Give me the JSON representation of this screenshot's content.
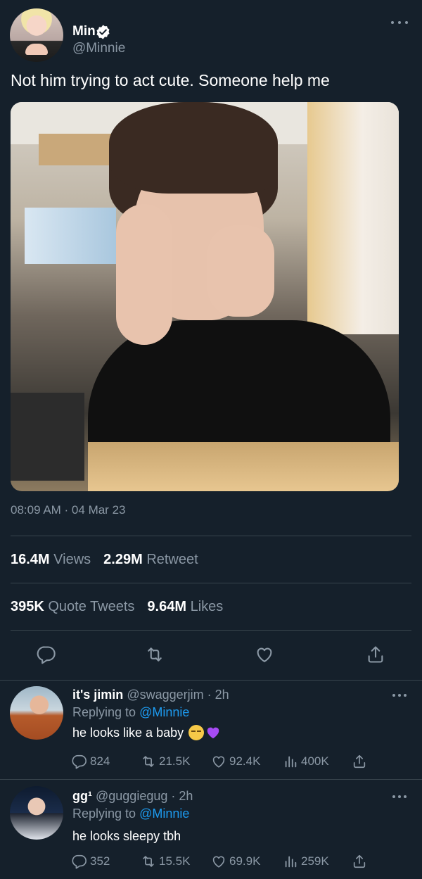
{
  "tweet": {
    "display_name": "Min",
    "handle": "@Minnie",
    "text": "Not him trying to act cute. Someone help me",
    "timestamp": "08:09 AM · 04 Mar 23",
    "stats": {
      "views_count": "16.4M",
      "views_label": "Views",
      "retweet_count": "2.29M",
      "retweet_label": "Retweet",
      "quote_count": "395K",
      "quote_label": "Quote Tweets",
      "likes_count": "9.64M",
      "likes_label": "Likes"
    }
  },
  "replies": [
    {
      "display_name": "it's jimin",
      "handle_time": "@swaggerjim · 2h",
      "replying_prefix": "Replying to",
      "replying_handle": "@Minnie",
      "text": "he looks like a baby",
      "emojis": [
        "pensive-face",
        "purple-heart"
      ],
      "comments": "824",
      "retweets": "21.5K",
      "likes": "92.4K",
      "views": "400K"
    },
    {
      "display_name": "gg¹",
      "handle_time": "@guggiegug · 2h",
      "replying_prefix": "Replying to",
      "replying_handle": "@Minnie",
      "text": "he looks sleepy tbh",
      "comments": "352",
      "retweets": "15.5K",
      "likes": "69.9K",
      "views": "259K"
    }
  ],
  "colors": {
    "background": "#15202b",
    "muted": "#8b98a5",
    "accent": "#1d9bf0",
    "divider": "#38444d"
  }
}
